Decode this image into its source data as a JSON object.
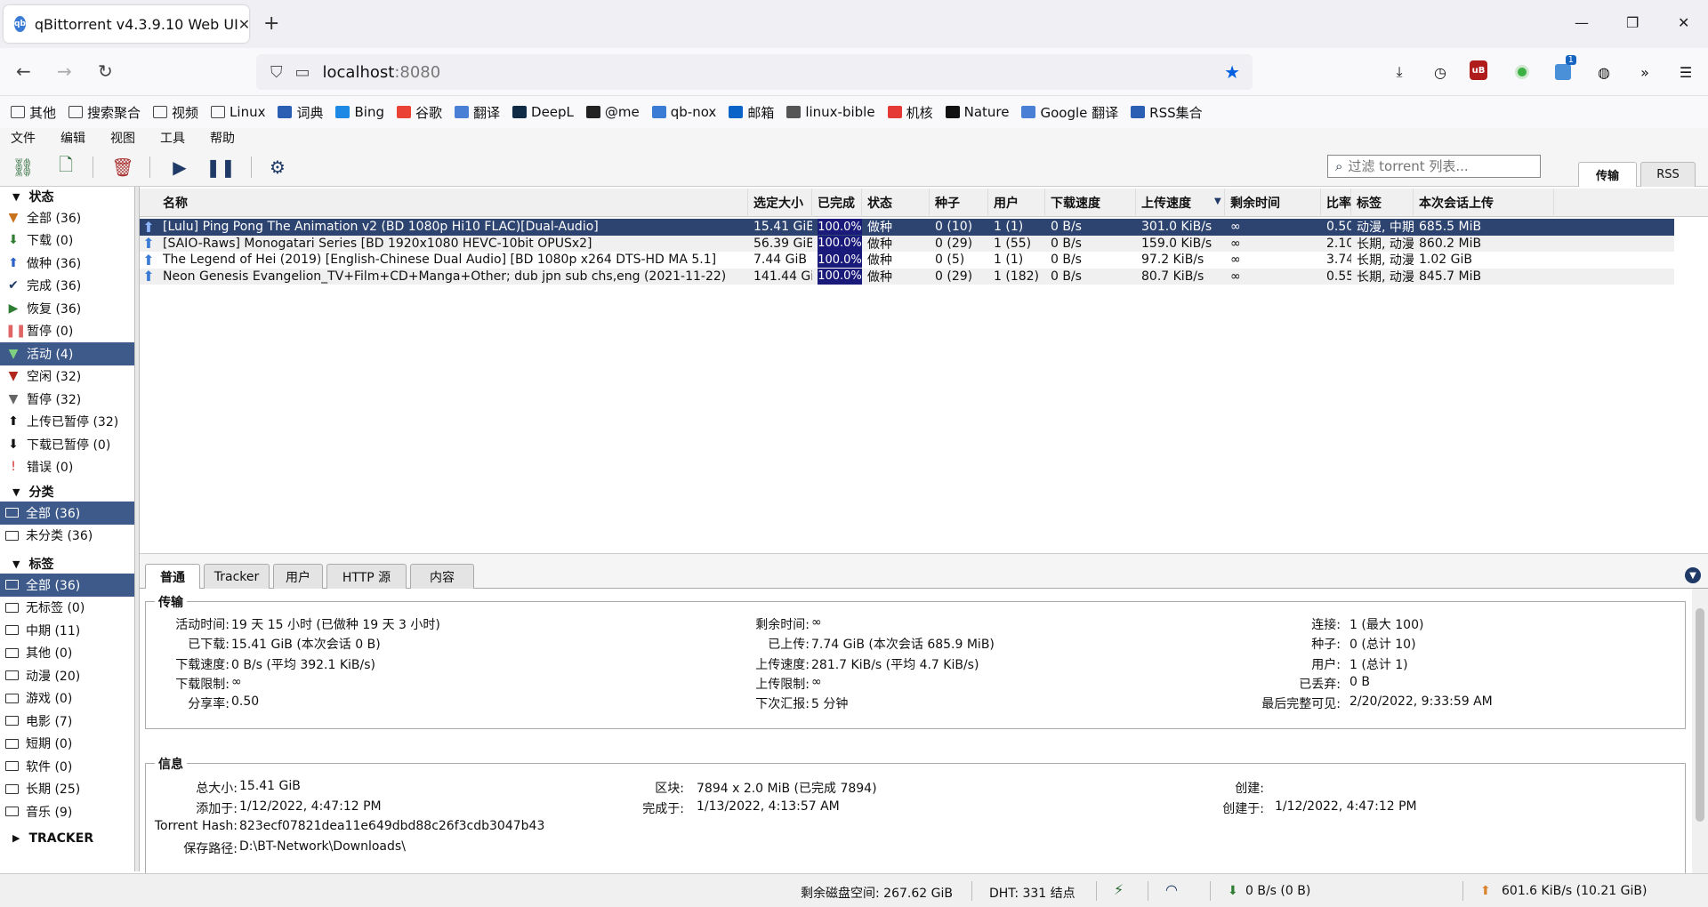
{
  "browser": {
    "tab_title": "qBittorrent v4.3.9.10 Web UI",
    "favicon_text": "qb",
    "url_host": "localhost",
    "url_port": ":8080",
    "ext_badge": "1",
    "bookmarks": [
      {
        "label": "其他",
        "icon": "folder-icon",
        "color": "#444"
      },
      {
        "label": "搜索聚合",
        "icon": "folder-icon",
        "color": "#444"
      },
      {
        "label": "视频",
        "icon": "folder-icon",
        "color": "#444"
      },
      {
        "label": "Linux",
        "icon": "folder-icon",
        "color": "#444"
      },
      {
        "label": "词典",
        "icon": "dict-icon",
        "color": "#2b5fb4"
      },
      {
        "label": "Bing",
        "icon": "bing-icon",
        "color": "#1e88e5"
      },
      {
        "label": "谷歌",
        "icon": "google-icon",
        "color": "#ea4335"
      },
      {
        "label": "翻译",
        "icon": "translate-icon",
        "color": "#4a7fd6"
      },
      {
        "label": "DeepL",
        "icon": "deepl-icon",
        "color": "#0f2b46"
      },
      {
        "label": "@me",
        "icon": "github-icon",
        "color": "#222"
      },
      {
        "label": "qb-nox",
        "icon": "qbittorrent-icon",
        "color": "#3a7bd5"
      },
      {
        "label": "邮箱",
        "icon": "outlook-icon",
        "color": "#0a64c8"
      },
      {
        "label": "linux-bible",
        "icon": "globe-icon",
        "color": "#555"
      },
      {
        "label": "机核",
        "icon": "gcores-icon",
        "color": "#e53935"
      },
      {
        "label": "Nature",
        "icon": "nature-icon",
        "color": "#111"
      },
      {
        "label": "Google 翻译",
        "icon": "translate-icon",
        "color": "#4a7fd6"
      },
      {
        "label": "RSS集合",
        "icon": "rss-icon",
        "color": "#2b5fb4"
      }
    ]
  },
  "app": {
    "menu": [
      "文件",
      "编辑",
      "视图",
      "工具",
      "帮助"
    ],
    "filter_placeholder": "过滤 torrent 列表...",
    "side_tabs": [
      "传输",
      "RSS"
    ],
    "status_header": "状态",
    "status_items": [
      {
        "label": "全部 (36)",
        "icon": "filter-icon",
        "color": "#c8731f"
      },
      {
        "label": "下载 (0)",
        "icon": "download-arrow-icon",
        "color": "#2f7d32"
      },
      {
        "label": "做种 (36)",
        "icon": "upload-arrow-icon",
        "color": "#2a62c9"
      },
      {
        "label": "完成 (36)",
        "icon": "checkmark-icon",
        "color": "#1f3a66"
      },
      {
        "label": "恢复 (36)",
        "icon": "play-icon",
        "color": "#2e7d32"
      },
      {
        "label": "暂停 (0)",
        "icon": "pause-icon",
        "color": "#e06666"
      },
      {
        "label": "活动 (4)",
        "icon": "filter-icon",
        "color": "#2e7d32",
        "selected": true
      },
      {
        "label": "空闲 (32)",
        "icon": "filter-icon",
        "color": "#b3261e"
      },
      {
        "label": "暂停 (32)",
        "icon": "filter-icon",
        "color": "#666"
      },
      {
        "label": "上传已暂停 (32)",
        "icon": "upload-arrow-icon",
        "color": "#111"
      },
      {
        "label": "下载已暂停 (0)",
        "icon": "download-arrow-icon",
        "color": "#111"
      },
      {
        "label": "错误 (0)",
        "icon": "error-icon",
        "color": "#d32f2f"
      }
    ],
    "category_header": "分类",
    "category_items": [
      {
        "label": "全部 (36)",
        "selected": true
      },
      {
        "label": "未分类 (36)"
      }
    ],
    "tag_header": "标签",
    "tag_items": [
      {
        "label": "全部 (36)",
        "selected": true
      },
      {
        "label": "无标签 (0)"
      },
      {
        "label": "中期 (11)"
      },
      {
        "label": "其他 (0)"
      },
      {
        "label": "动漫 (20)"
      },
      {
        "label": "游戏 (0)"
      },
      {
        "label": "电影 (7)"
      },
      {
        "label": "短期 (0)"
      },
      {
        "label": "软件 (0)"
      },
      {
        "label": "长期 (25)"
      },
      {
        "label": "音乐 (9)"
      }
    ],
    "tracker_header": "TRACKER",
    "columns": [
      "名称",
      "选定大小",
      "已完成",
      "状态",
      "种子",
      "用户",
      "下载速度",
      "上传速度",
      "剩余时间",
      "比率",
      "标签",
      "本次会话上传"
    ],
    "torrents": [
      {
        "name": "[Lulu] Ping Pong The Animation v2 (BD 1080p Hi10 FLAC)[Dual-Audio]",
        "size": "15.41 GiB",
        "done": "100.0%",
        "status": "做种",
        "seeds": "0 (10)",
        "peers": "1 (1)",
        "dl": "0 B/s",
        "ul": "301.0 KiB/s",
        "eta": "∞",
        "ratio": "0.50",
        "tags": "动漫, 中期",
        "session_up": "685.5 MiB"
      },
      {
        "name": "[SAIO-Raws] Monogatari Series [BD 1920x1080 HEVC-10bit OPUSx2]",
        "size": "56.39 GiB",
        "done": "100.0%",
        "status": "做种",
        "seeds": "0 (29)",
        "peers": "1 (55)",
        "dl": "0 B/s",
        "ul": "159.0 KiB/s",
        "eta": "∞",
        "ratio": "2.10",
        "tags": "长期, 动漫",
        "session_up": "860.2 MiB"
      },
      {
        "name": "The Legend of Hei (2019) [English-Chinese Dual Audio] [BD 1080p x264 DTS-HD MA 5.1]",
        "size": "7.44 GiB",
        "done": "100.0%",
        "status": "做种",
        "seeds": "0 (5)",
        "peers": "1 (1)",
        "dl": "0 B/s",
        "ul": "97.2 KiB/s",
        "eta": "∞",
        "ratio": "3.74",
        "tags": "长期, 动漫",
        "session_up": "1.02 GiB"
      },
      {
        "name": "Neon Genesis Evangelion_TV+Film+CD+Manga+Other; dub jpn sub chs,eng (2021-11-22)",
        "size": "141.44 GiB",
        "done": "100.0%",
        "status": "做种",
        "seeds": "0 (29)",
        "peers": "1 (182)",
        "dl": "0 B/s",
        "ul": "80.7 KiB/s",
        "eta": "∞",
        "ratio": "0.55",
        "tags": "长期, 动漫",
        "session_up": "845.7 MiB"
      }
    ],
    "detail_tabs": [
      "普通",
      "Tracker",
      "用户",
      "HTTP 源",
      "内容"
    ],
    "transfer": {
      "legend": "传输",
      "active_time_k": "活动时间:",
      "active_time_v": "19 天 15 小时 (已做种 19 天 3 小时)",
      "downloaded_k": "已下载:",
      "downloaded_v": "15.41 GiB (本次会话 0 B)",
      "dl_speed_k": "下载速度:",
      "dl_speed_v": "0 B/s (平均 392.1 KiB/s)",
      "dl_limit_k": "下载限制:",
      "dl_limit_v": "∞",
      "share_k": "分享率:",
      "share_v": "0.50",
      "eta_k": "剩余时间:",
      "eta_v": "∞",
      "uploaded_k": "已上传:",
      "uploaded_v": "7.74 GiB (本次会话 685.9 MiB)",
      "ul_speed_k": "上传速度:",
      "ul_speed_v": "281.7 KiB/s (平均 4.7 KiB/s)",
      "ul_limit_k": "上传限制:",
      "ul_limit_v": "∞",
      "reannounce_k": "下次汇报:",
      "reannounce_v": "5 分钟",
      "conn_k": "连接:",
      "conn_v": "1 (最大 100)",
      "seeds_k": "种子:",
      "seeds_v": "0 (总计 10)",
      "peers_k": "用户:",
      "peers_v": "1 (总计 1)",
      "wasted_k": "已丢弃:",
      "wasted_v": "0 B",
      "last_seen_k": "最后完整可见:",
      "last_seen_v": "2/20/2022, 9:33:59 AM"
    },
    "info": {
      "legend": "信息",
      "total_size_k": "总大小:",
      "total_size_v": "15.41 GiB",
      "added_k": "添加于:",
      "added_v": "1/12/2022, 4:47:12 PM",
      "hash_k": "Torrent Hash:",
      "hash_v": "823ecf07821dea11e649dbd88c26f3cdb3047b43",
      "path_k": "保存路径:",
      "path_v": "D:\\BT-Network\\Downloads\\",
      "pieces_k": "区块:",
      "pieces_v": "7894 x 2.0 MiB (已完成 7894)",
      "completed_k": "完成于:",
      "completed_v": "1/13/2022, 4:13:57 AM",
      "creator_k": "创建:",
      "creator_v": "",
      "created_k": "创建于:",
      "created_v": "1/12/2022, 4:47:12 PM"
    },
    "statusbar": {
      "free_space": "剩余磁盘空间: 267.62 GiB",
      "dht": "DHT: 331 结点",
      "dl": "0 B/s (0 B)",
      "ul": "601.6 KiB/s (10.21 GiB)"
    }
  }
}
